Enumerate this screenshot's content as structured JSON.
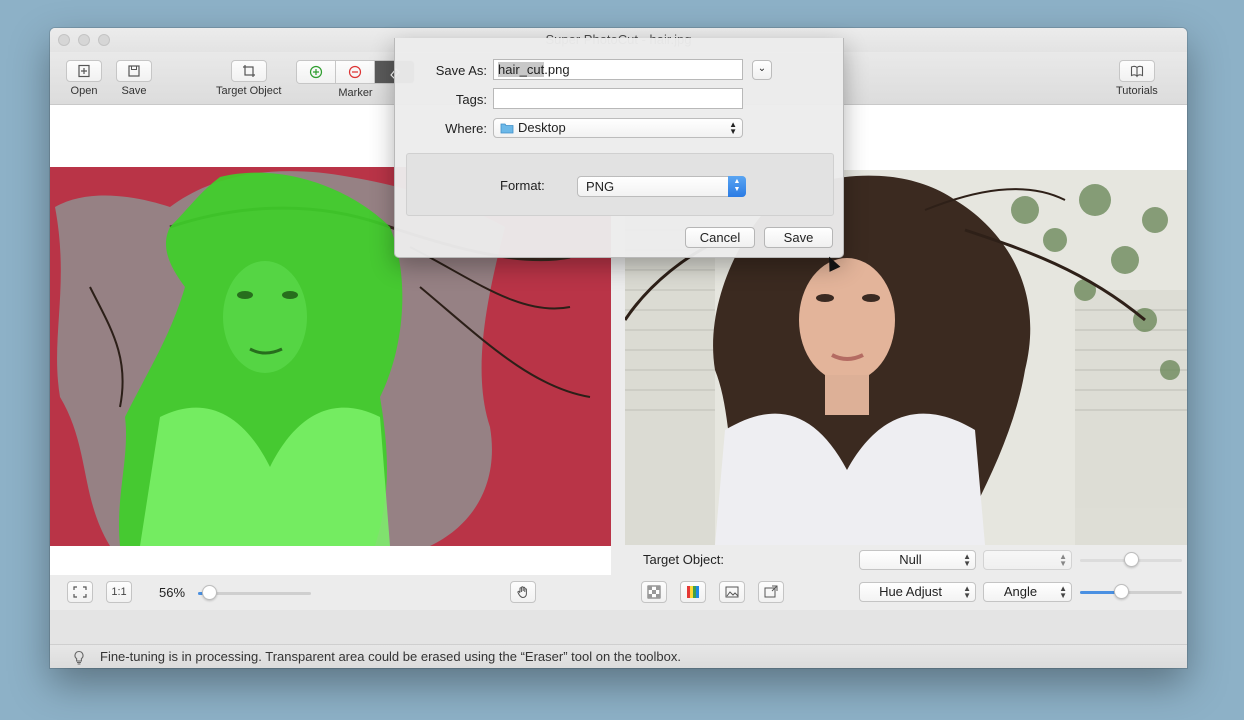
{
  "window": {
    "title": "Super PhotoCut - hair.jpg"
  },
  "toolbar": {
    "open_label": "Open",
    "save_label": "Save",
    "target_object_label": "Target Object",
    "marker_label": "Marker",
    "tutorials_label": "Tutorials"
  },
  "left_panel": {
    "zoom_value": "56%",
    "one_to_one_label": "1:1",
    "zoom_slider_fraction": 0.1
  },
  "right_panel": {
    "target_object_label": "Target Object:",
    "target_select_value": "Null",
    "empty_select_value": "",
    "hue_select_value": "Hue Adjust",
    "angle_select_value": "Angle",
    "top_slider_fraction": 0.5,
    "bottom_slider_fraction": 0.4
  },
  "save_dialog": {
    "save_as_label": "Save As:",
    "filename_selected": "hair_cut",
    "filename_ext": ".png",
    "tags_label": "Tags:",
    "tags_value": "",
    "where_label": "Where:",
    "where_value": "Desktop",
    "format_label": "Format:",
    "format_value": "PNG",
    "cancel_label": "Cancel",
    "save_label": "Save"
  },
  "status": {
    "message": "Fine-tuning is in processing. Transparent area could be erased using the “Eraser” tool on the toolbox."
  },
  "colors": {
    "accent": "#4a90e2",
    "mask_green": "#3fcf2a",
    "background_red": "#b93447"
  }
}
